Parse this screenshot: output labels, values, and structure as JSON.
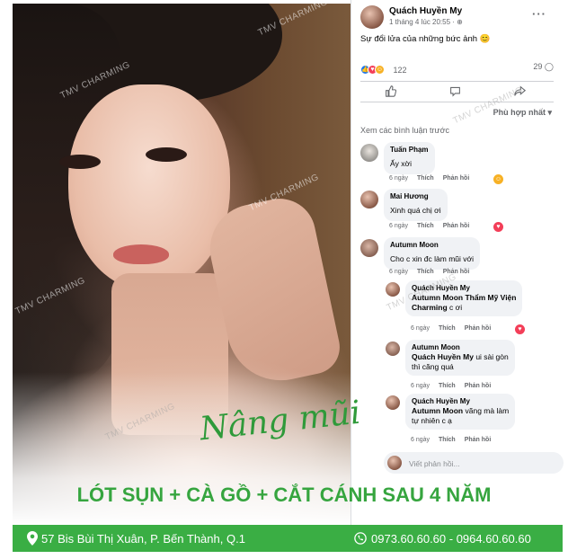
{
  "watermark": "TMV CHARMING",
  "script_title": "Nâng mũi",
  "headline": "LÓT SỤN + CÀ GỒ + CẮT CÁNH SAU 4 NĂM",
  "footer": {
    "address": "57 Bis Bùi Thị Xuân, P. Bến Thành, Q.1",
    "phones": "0973.60.60.60 - 0964.60.60.60"
  },
  "colors": {
    "accent_green": "#3aae44",
    "text_green": "#36a53f",
    "fb_blue": "#1877f2"
  },
  "post": {
    "author": "Quách Huyền My",
    "time": "1 tháng 4 lúc 20:55 · ⊕",
    "text": "Sự đổi lửa của những bức ảnh 😊",
    "reaction_count": "122",
    "comment_count": "29 ◯",
    "sort_label": "Phù hợp nhất ▾",
    "previous_comments": "Xem các bình luận trước",
    "reply_placeholder": "Viết phản hồi..."
  },
  "comments": [
    {
      "name": "Tuấn Phạm",
      "text": "Ấy xời",
      "time": "6 ngày",
      "like": "Thích",
      "reply": "Phản hồi",
      "reaction": "haha"
    },
    {
      "name": "Mai Hương",
      "text": "Xinh quá chị ơi",
      "time": "6 ngày",
      "like": "Thích",
      "reply": "Phản hồi",
      "reaction": "love"
    },
    {
      "name": "Autumn Moon",
      "text": "Cho c xin đc làm mũi với",
      "time": "6 ngày",
      "like": "Thích",
      "reply": "Phản hồi",
      "reaction": ""
    }
  ],
  "replies": [
    {
      "name": "Quách Huyền My",
      "mention": "Autumn Moon Thẩm Mỹ Viện",
      "line2_bold": "Charming",
      "line2": " c ơi",
      "time": "6 ngày",
      "like": "Thích",
      "reply": "Phản hồi",
      "reaction": "love"
    },
    {
      "name": "Autumn Moon",
      "mention": "Quách Huyền My",
      "mention_rest": " ui sài gòn",
      "line2": "thì căng quá",
      "time": "6 ngày",
      "like": "Thích",
      "reply": "Phản hồi",
      "reaction": ""
    },
    {
      "name": "Quách Huyền My",
      "mention": "Autumn Moon",
      "mention_rest": " vãng mà làm",
      "line2": "tự nhiên c ạ",
      "time": "6 ngày",
      "like": "Thích",
      "reply": "Phản hồi",
      "reaction": ""
    }
  ]
}
